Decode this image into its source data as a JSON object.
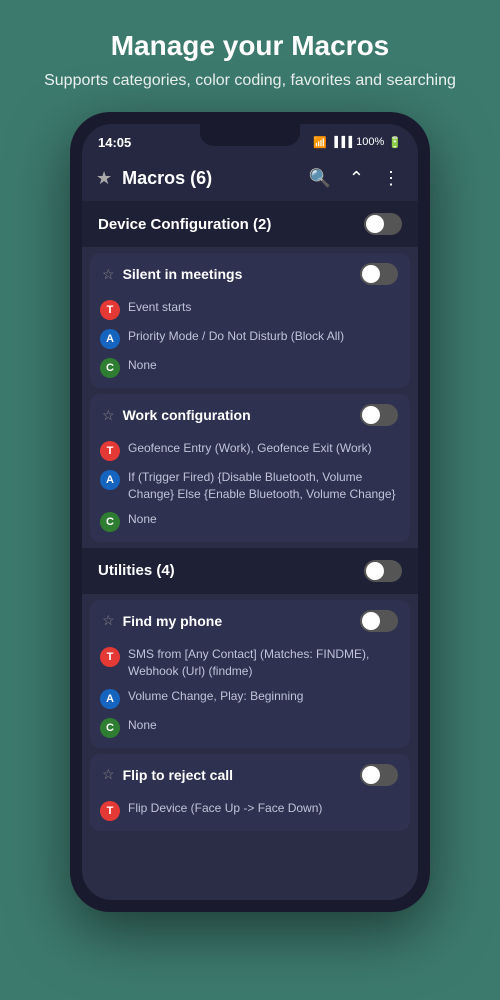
{
  "header": {
    "title": "Manage your Macros",
    "subtitle": "Supports categories, color coding, favorites and searching"
  },
  "status_bar": {
    "time": "14:05",
    "signal": "WiFi",
    "battery": "100%"
  },
  "toolbar": {
    "star_label": "☆",
    "title": "Macros (6)",
    "search_icon": "🔍",
    "collapse_icon": "⋀",
    "menu_icon": "⋮"
  },
  "categories": [
    {
      "id": "device-config",
      "title": "Device Configuration (2)",
      "toggle": false,
      "macros": [
        {
          "id": "silent-meetings",
          "title": "Silent in meetings",
          "toggle": false,
          "trigger": "Event starts",
          "action": "Priority Mode / Do Not Disturb (Block All)",
          "condition": "None"
        },
        {
          "id": "work-config",
          "title": "Work configuration",
          "toggle": false,
          "trigger": "Geofence Entry (Work), Geofence Exit (Work)",
          "action": "If (Trigger Fired) {Disable Bluetooth, Volume Change} Else {Enable Bluetooth, Volume Change}",
          "condition": "None"
        }
      ]
    },
    {
      "id": "utilities",
      "title": "Utilities (4)",
      "toggle": false,
      "macros": [
        {
          "id": "find-my-phone",
          "title": "Find my phone",
          "toggle": false,
          "trigger": "SMS from [Any Contact] (Matches: FINDME), Webhook (Url) (findme)",
          "action": "Volume Change, Play: Beginning",
          "condition": "None"
        },
        {
          "id": "flip-to-reject",
          "title": "Flip to reject call",
          "toggle": false,
          "trigger": "Flip Device (Face Up -> Face Down)",
          "action": "",
          "condition": ""
        }
      ]
    }
  ],
  "badge_labels": {
    "trigger": "T",
    "action": "A",
    "condition": "C"
  }
}
